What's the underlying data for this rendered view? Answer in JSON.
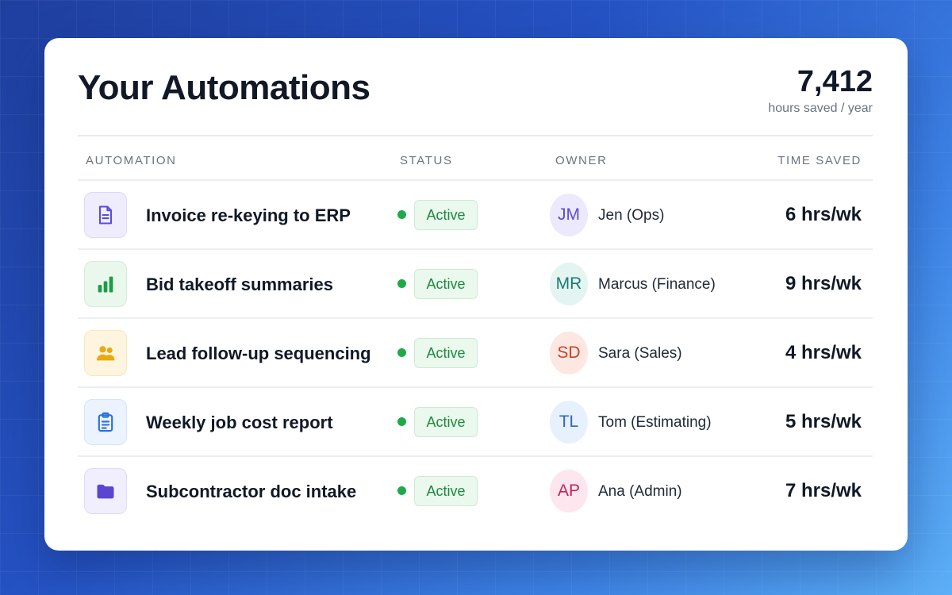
{
  "header": {
    "title": "Your Automations",
    "stat_value": "7,412",
    "stat_caption": "hours saved / year"
  },
  "columns": {
    "automation": "AUTOMATION",
    "status": "STATUS",
    "owner": "OWNER",
    "time_saved": "TIME SAVED"
  },
  "colors": {
    "status_active": "#1faa4a",
    "background_start": "#1f3f9e",
    "background_end": "#5db0f7"
  },
  "rows": [
    {
      "icon": "document-icon",
      "name": "Invoice re-keying to ERP",
      "status": "Active",
      "owner_initials": "JM",
      "owner_name": "Jen (Ops)",
      "time_saved": "6 hrs/wk"
    },
    {
      "icon": "bar-chart-icon",
      "name": "Bid takeoff summaries",
      "status": "Active",
      "owner_initials": "MR",
      "owner_name": "Marcus (Finance)",
      "time_saved": "9 hrs/wk"
    },
    {
      "icon": "users-icon",
      "name": "Lead follow-up sequencing",
      "status": "Active",
      "owner_initials": "SD",
      "owner_name": "Sara (Sales)",
      "time_saved": "4 hrs/wk"
    },
    {
      "icon": "clipboard-icon",
      "name": "Weekly job cost report",
      "status": "Active",
      "owner_initials": "TL",
      "owner_name": "Tom (Estimating)",
      "time_saved": "5 hrs/wk"
    },
    {
      "icon": "folder-icon",
      "name": "Subcontractor doc intake",
      "status": "Active",
      "owner_initials": "AP",
      "owner_name": "Ana (Admin)",
      "time_saved": "7 hrs/wk"
    }
  ]
}
